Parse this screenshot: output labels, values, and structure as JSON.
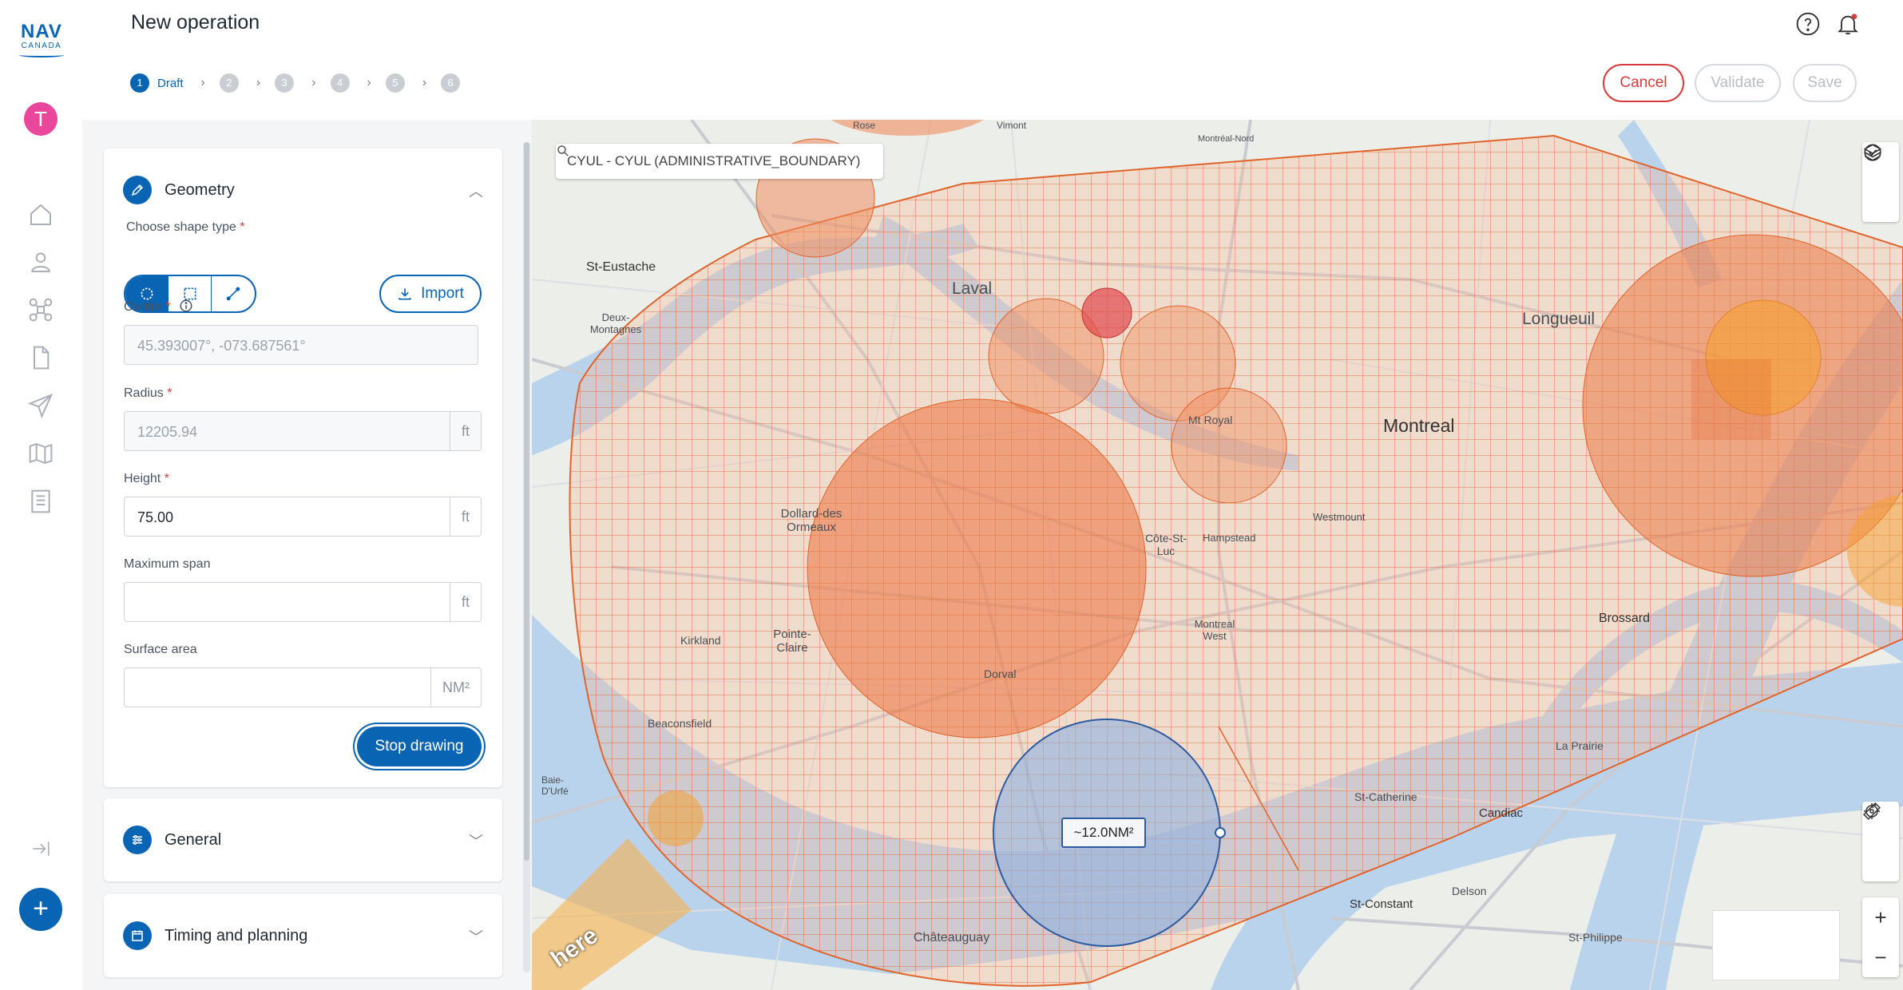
{
  "app": {
    "logo_top": "NAV",
    "logo_bottom": "CANADA",
    "avatar_initial": "T",
    "page_title": "New operation",
    "brand_color": "#0a64b4"
  },
  "stepper": {
    "steps": [
      {
        "num": "1",
        "label": "Draft",
        "active": true
      },
      {
        "num": "2"
      },
      {
        "num": "3"
      },
      {
        "num": "4"
      },
      {
        "num": "5"
      },
      {
        "num": "6"
      }
    ]
  },
  "actions": {
    "cancel": "Cancel",
    "validate": "Validate",
    "save": "Save"
  },
  "geometry": {
    "title": "Geometry",
    "shape_label": "Choose shape type",
    "import_label": "Import",
    "centre_label": "Centre",
    "centre_placeholder": "45.393007°, -073.687561°",
    "radius_label": "Radius",
    "radius_value": "12205.94",
    "radius_unit": "ft",
    "height_label": "Height",
    "height_value": "75.00",
    "height_unit": "ft",
    "span_label": "Maximum span",
    "span_value": "",
    "span_unit": "ft",
    "area_label": "Surface area",
    "area_value": "",
    "area_unit": "NM²",
    "stop_drawing": "Stop drawing",
    "required_mark": "*"
  },
  "sections": {
    "general": "General",
    "timing": "Timing and planning"
  },
  "map": {
    "search_text": "CYUL - CYUL (ADMINISTRATIVE_BOUNDARY)",
    "area_tooltip": "~12.0NM²",
    "attribution": "here",
    "labels": {
      "laval": "Laval",
      "montreal": "Montreal",
      "longueuil": "Longueuil",
      "st_eustache": "St-Eustache",
      "deux_montagnes": "Deux-Montagnes",
      "dollard": "Dollard-des Ormeaux",
      "pointe_claire": "Pointe-Claire",
      "kirkland": "Kirkland",
      "beaconsfield": "Beaconsfield",
      "brossard": "Brossard",
      "candiac": "Candiac",
      "st_constant": "St-Constant",
      "st_catherine": "St-Catherine",
      "chateauguay": "Châteauguay",
      "la_prairie": "La Prairie",
      "delson": "Delson",
      "st_philippe": "St-Philippe",
      "cote_st_luc": "Côte-St-Luc",
      "montreal_west": "Montreal West",
      "dorval": "Dorval",
      "westmount": "Westmount",
      "hampstead": "Hampstead",
      "mt_royal": "Mt Royal",
      "baie_durfe": "Baie-D'Urfé",
      "rose": "Rose",
      "vimont": "Vimont",
      "montreal_nord": "Montréal-Nord"
    }
  }
}
